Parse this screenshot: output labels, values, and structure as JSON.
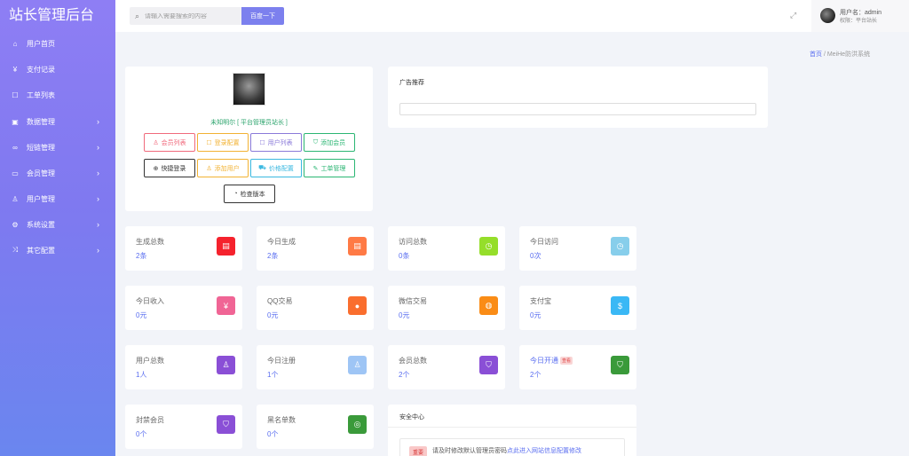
{
  "sidebar": {
    "title": "站长管理后台",
    "items": [
      {
        "label": "用户首页",
        "icon": "home-icon"
      },
      {
        "label": "支付记录",
        "icon": "yen-icon"
      },
      {
        "label": "工单列表",
        "icon": "ticket-icon"
      },
      {
        "label": "数据管理",
        "icon": "briefcase-icon"
      },
      {
        "label": "短链管理",
        "icon": "link-icon"
      },
      {
        "label": "会员管理",
        "icon": "cart-icon"
      },
      {
        "label": "用户管理",
        "icon": "user-icon"
      },
      {
        "label": "系统设置",
        "icon": "gear-icon"
      },
      {
        "label": "其它配置",
        "icon": "shuffle-icon"
      }
    ]
  },
  "header": {
    "search_placeholder": "请输入需要搜索的内容",
    "search_button": "百度一下",
    "username": "用户名：admin",
    "role": "权限：平台站长"
  },
  "breadcrumb": {
    "home": "首页",
    "current": "MeiHe防洪系统"
  },
  "profile": {
    "name": "未知明尔 [ 平台管理员站长 ]",
    "buttons": [
      {
        "label": "会员列表",
        "color": "#f06a7c"
      },
      {
        "label": "登录配置",
        "color": "#f2b233"
      },
      {
        "label": "用户列表",
        "color": "#8a7ad9"
      },
      {
        "label": "添加会员",
        "color": "#2bb673"
      },
      {
        "label": "快捷登录",
        "color": "#333333"
      },
      {
        "label": "添加用户",
        "color": "#f2b233"
      },
      {
        "label": "价格配置",
        "color": "#3ab8e0"
      },
      {
        "label": "工单管理",
        "color": "#2bb673"
      },
      {
        "label": "检查版本",
        "color": "#333333"
      }
    ]
  },
  "ad": {
    "title": "广告推荐"
  },
  "stats": [
    {
      "label": "生成总数",
      "value": "2条",
      "color": "#f5222d",
      "icon": "document-icon"
    },
    {
      "label": "今日生成",
      "value": "2条",
      "color": "#ff7a45",
      "icon": "document-icon"
    },
    {
      "label": "访问总数",
      "value": "0条",
      "color": "#95de2a",
      "icon": "clock-icon"
    },
    {
      "label": "今日访问",
      "value": "0次",
      "color": "#87ceeb",
      "icon": "clock-icon"
    },
    {
      "label": "今日收入",
      "value": "0元",
      "color": "#f06595",
      "icon": "yen-icon"
    },
    {
      "label": "QQ交易",
      "value": "0元",
      "color": "#fa6e2e",
      "icon": "qq-icon"
    },
    {
      "label": "微信交易",
      "value": "0元",
      "color": "#fa8c16",
      "icon": "wechat-icon"
    },
    {
      "label": "支付宝",
      "value": "0元",
      "color": "#3ab8f5",
      "icon": "alipay-icon"
    },
    {
      "label": "用户总数",
      "value": "1人",
      "color": "#8a4fd6",
      "icon": "user-icon"
    },
    {
      "label": "今日注册",
      "value": "1个",
      "color": "#9ec5f5",
      "icon": "user-icon"
    },
    {
      "label": "会员总数",
      "value": "2个",
      "color": "#8a4fd6",
      "icon": "shield-icon"
    },
    {
      "label": "今日开通",
      "value": "2个",
      "color": "#3a9a3a",
      "icon": "shield-icon",
      "badge": "查看"
    },
    {
      "label": "封禁会员",
      "value": "0个",
      "color": "#8a4fd6",
      "icon": "shield-icon"
    },
    {
      "label": "黑名单数",
      "value": "0个",
      "color": "#3a9a3a",
      "icon": "globe-icon"
    }
  ],
  "security": {
    "title": "安全中心",
    "tag": "重要",
    "text": "请及时修改默认管理员密码",
    "link": "点此进入网站信息配置修改"
  }
}
